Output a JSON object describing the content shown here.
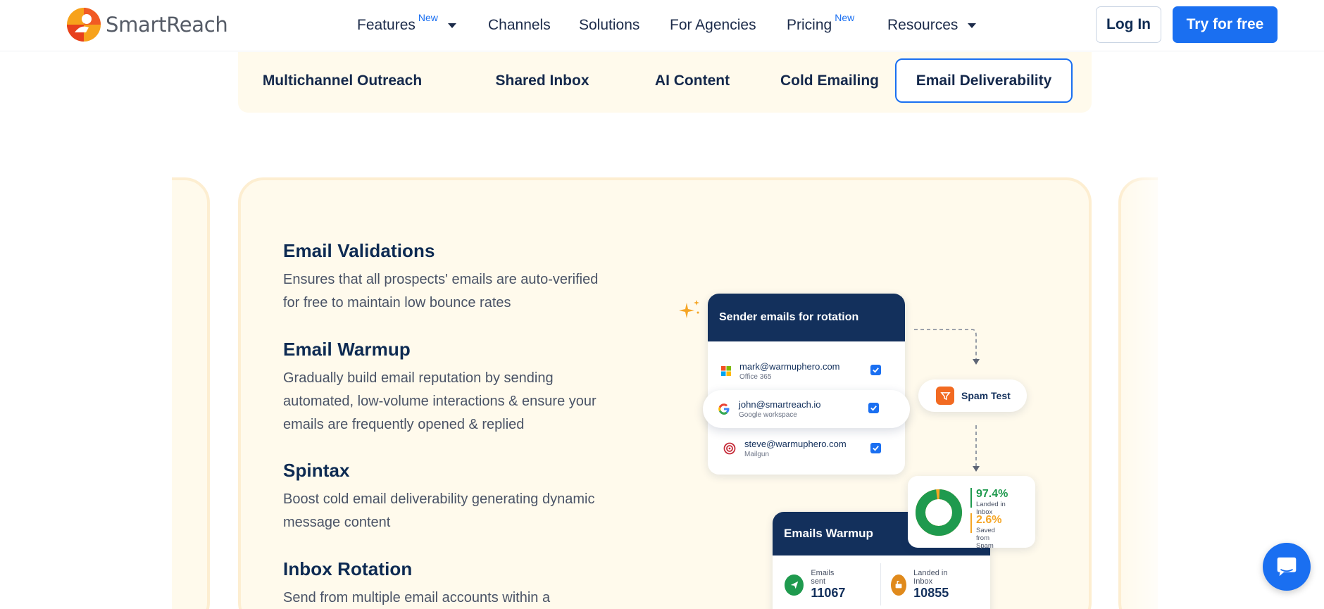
{
  "brand": {
    "name": "SmartReach"
  },
  "nav": {
    "items": [
      {
        "label": "Features",
        "badge": "New"
      },
      {
        "label": "Channels"
      },
      {
        "label": "Solutions"
      },
      {
        "label": "For Agencies"
      },
      {
        "label": "Pricing",
        "badge": "New"
      },
      {
        "label": "Resources"
      }
    ],
    "login_label": "Log In",
    "try_label": "Try for free"
  },
  "tabs": [
    {
      "label": "Multichannel Outreach",
      "active": false
    },
    {
      "label": "Shared Inbox",
      "active": false
    },
    {
      "label": "AI Content",
      "active": false
    },
    {
      "label": "Cold Emailing",
      "active": false
    },
    {
      "label": "Email Deliverability",
      "active": true
    }
  ],
  "features": [
    {
      "title": "Email Validations",
      "desc": "Ensures that all prospects' emails are auto-verified for free to maintain low bounce rates"
    },
    {
      "title": "Email Warmup",
      "desc": "Gradually build email reputation by sending automated, low-volume interactions & ensure your emails are frequently opened & replied"
    },
    {
      "title": "Spintax",
      "desc": "Boost cold email deliverability generating dynamic message content"
    },
    {
      "title": "Inbox Rotation",
      "desc": "Send from multiple email accounts within a"
    }
  ],
  "illustration": {
    "rotation_title": "Sender emails for rotation",
    "senders": [
      {
        "email": "mark@warmuphero.com",
        "provider": "Office 365",
        "icon": "microsoft-icon"
      },
      {
        "email": "john@smartreach.io",
        "provider": "Google workspace",
        "icon": "google-icon"
      },
      {
        "email": "steve@warmuphero.com",
        "provider": "Mailgun",
        "icon": "mailgun-icon"
      }
    ],
    "spam_test_label": "Spam Test",
    "stats": {
      "inbox_pct": "97.4%",
      "inbox_label": "Landed in Inbox",
      "spam_pct": "2.6%",
      "spam_label": "Saved from Spam",
      "inbox_fraction": 0.974
    },
    "warmup": {
      "title": "Emails Warmup",
      "sent_label": "Emails sent",
      "sent_value": "11067",
      "landed_label": "Landed in Inbox",
      "landed_value": "10855"
    }
  },
  "colors": {
    "primary": "#1a6ff1",
    "navy": "#13305c",
    "cream": "#fffaec",
    "green": "#1f9a4e",
    "orange": "#f5a524"
  }
}
